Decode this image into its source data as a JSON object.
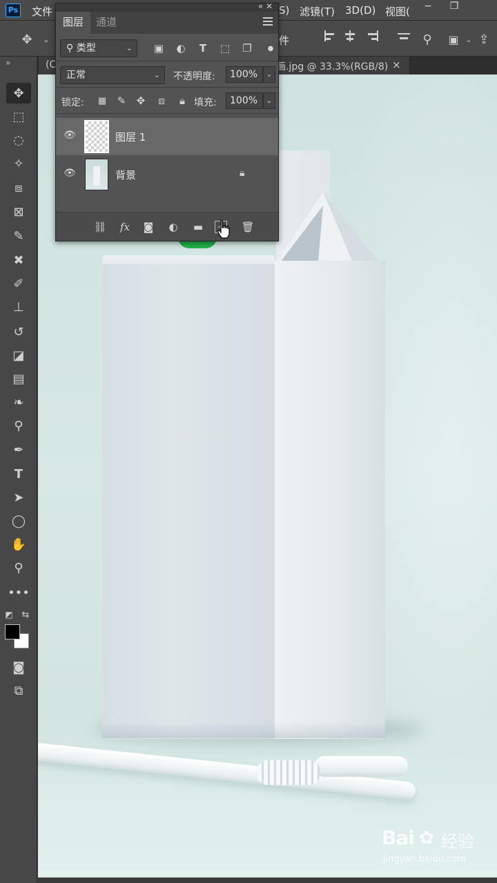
{
  "menubar": {
    "logo": "Ps",
    "items": [
      "文件",
      "S)",
      "滤镜(T)",
      "3D(D)",
      "视图("
    ],
    "window": {
      "minimize": "−",
      "restore": "❐"
    }
  },
  "options": {
    "partial_label": "件"
  },
  "document_tab": {
    "left": "(C",
    "right": "画.jpg @ 33.3%(RGB/8)",
    "close": "×"
  },
  "toolbar": {
    "collapse": "»"
  },
  "layers_panel": {
    "collapse_glyph": "«  ✕",
    "tabs": [
      "图层",
      "通道"
    ],
    "filter": {
      "label": "类型"
    },
    "blend_mode": "正常",
    "opacity": {
      "label": "不透明度:",
      "value": "100%"
    },
    "lock": {
      "label": "锁定:"
    },
    "fill": {
      "label": "填充:",
      "value": "100%"
    },
    "layers": [
      {
        "name": "图层 1",
        "selected": true
      },
      {
        "name": "背景",
        "selected": false,
        "locked": true
      }
    ],
    "footer_fx": "fx"
  },
  "watermark": {
    "logo": "Bai",
    "brand_cn": "经验",
    "url": "jingyan.baidu.com"
  },
  "colors": {
    "foreground": "#000000",
    "background": "#ffffff",
    "cap_green": "#22b34a",
    "ps_blue": "#31a8ff"
  }
}
